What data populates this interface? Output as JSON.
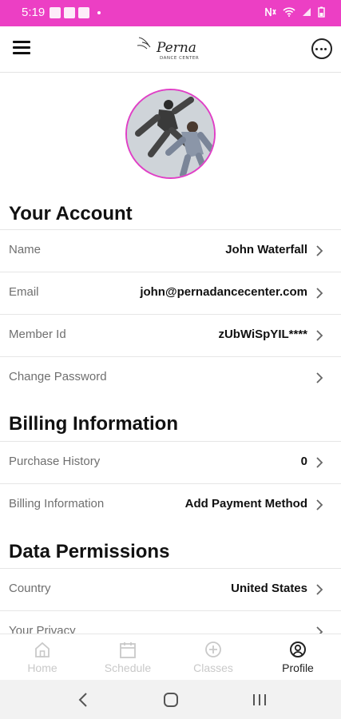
{
  "status_bar": {
    "time": "5:19"
  },
  "app_bar": {
    "logo_name": "Perna",
    "logo_tagline": "DANCE CENTER"
  },
  "account": {
    "title": "Your Account",
    "rows": [
      {
        "label": "Name",
        "value": "John Waterfall"
      },
      {
        "label": "Email",
        "value": "john@pernadancecenter.com"
      },
      {
        "label": "Member Id",
        "value": "zUbWiSpYIL****"
      },
      {
        "label": "Change Password",
        "value": ""
      }
    ]
  },
  "billing": {
    "title": "Billing Information",
    "rows": [
      {
        "label": "Purchase History",
        "value": "0"
      },
      {
        "label": "Billing Information",
        "value": "Add Payment Method"
      }
    ]
  },
  "permissions": {
    "title": "Data Permissions",
    "rows": [
      {
        "label": "Country",
        "value": "United States"
      },
      {
        "label": "Your Privacy",
        "value": ""
      }
    ]
  },
  "tabs": [
    {
      "label": "Home",
      "icon": "home-icon",
      "active": false
    },
    {
      "label": "Schedule",
      "icon": "calendar-icon",
      "active": false
    },
    {
      "label": "Classes",
      "icon": "plus-circle-icon",
      "active": false
    },
    {
      "label": "Profile",
      "icon": "user-circle-icon",
      "active": true
    }
  ],
  "colors": {
    "accent": "#ec3fc4",
    "avatar_border": "#e040c6"
  }
}
